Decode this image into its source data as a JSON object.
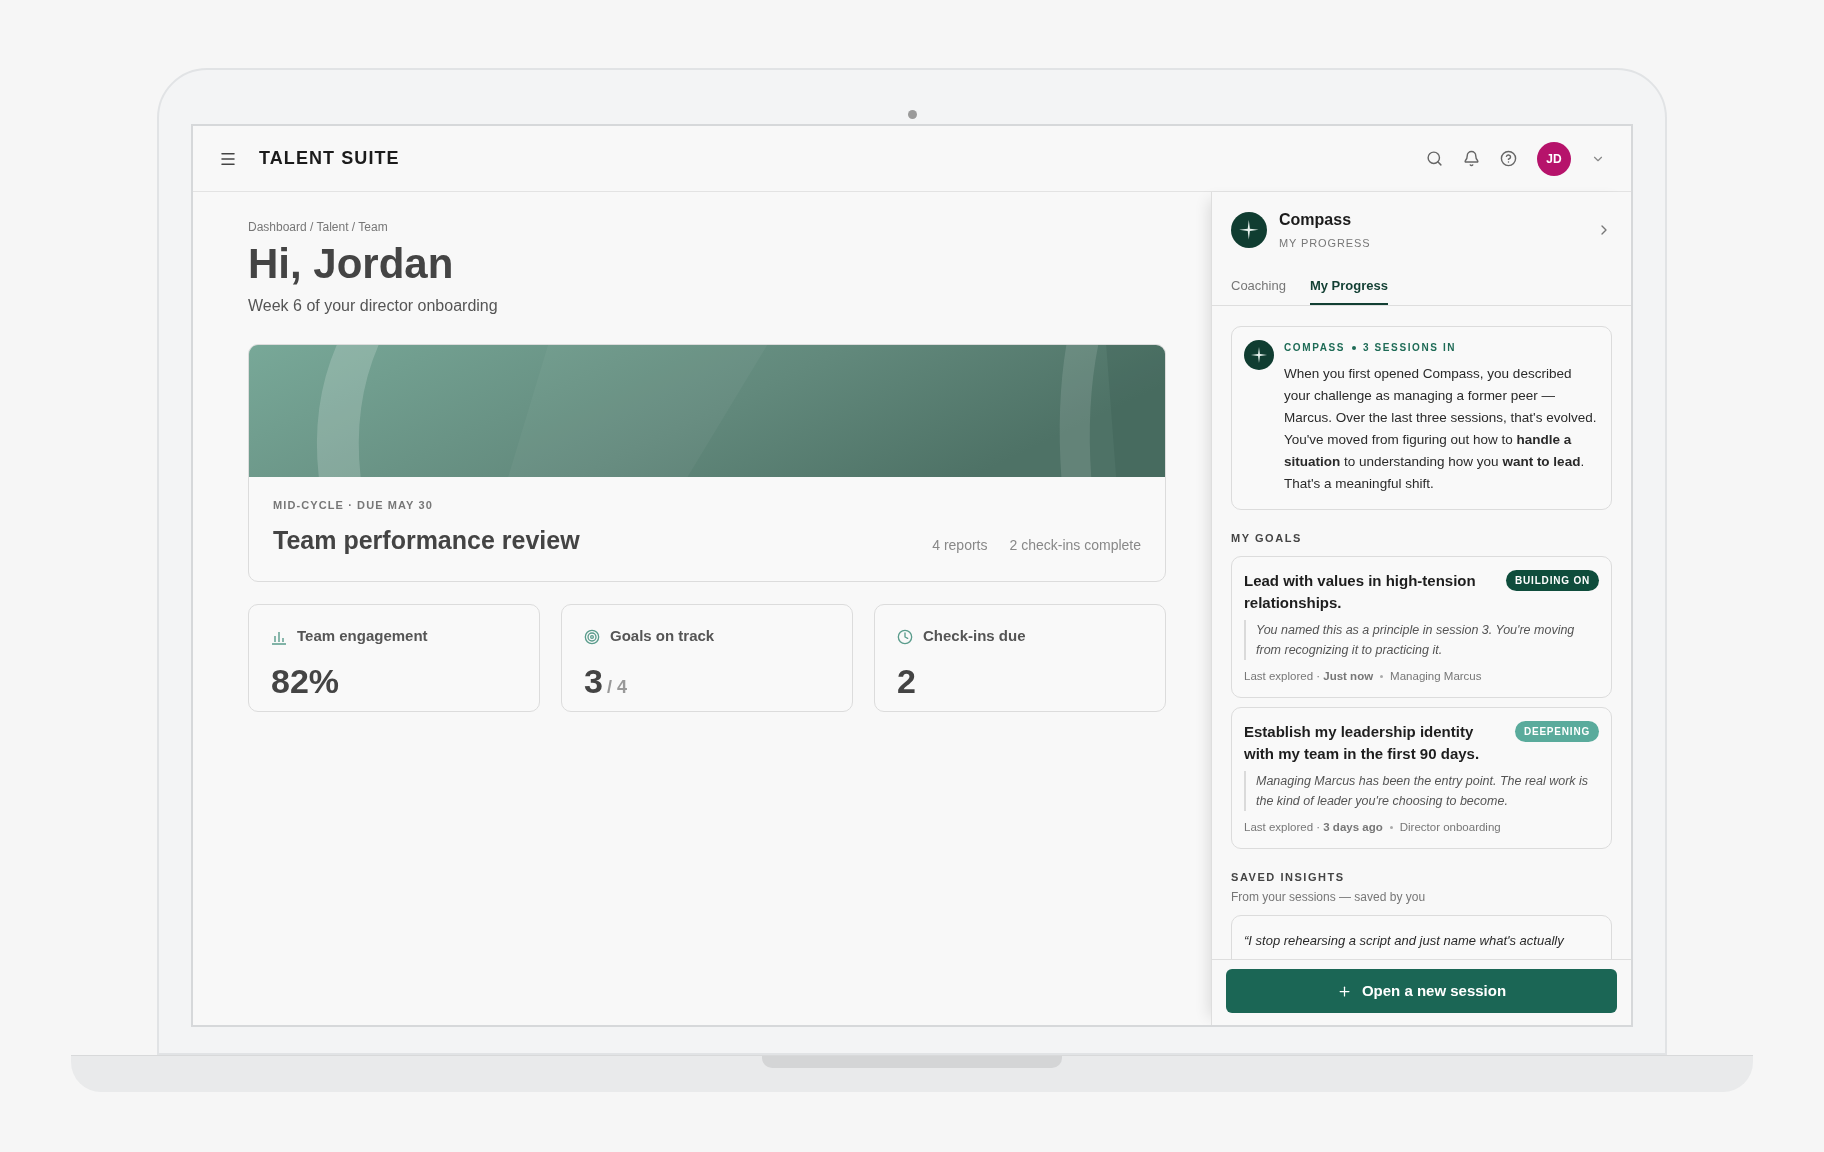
{
  "header": {
    "title": "TALENT SUITE",
    "avatar": "JD"
  },
  "main": {
    "breadcrumb": "Dashboard / Talent / Team",
    "greeting": "Hi, Jordan",
    "subtitle": "Week 6 of your director onboarding",
    "review": {
      "kind": "picture",
      "meta": "MID-CYCLE · DUE MAY 30",
      "title": "Team performance review",
      "stats": [
        "4 reports",
        "2 check-ins complete"
      ]
    },
    "metrics": [
      {
        "kind": "chart",
        "label": "Team engagement",
        "value": "82%"
      },
      {
        "kind": "target",
        "label": "Goals on track",
        "value": "3",
        "total": "/ 4"
      },
      {
        "kind": "clock",
        "label": "Check-ins due",
        "value": "2"
      }
    ]
  },
  "panel": {
    "name": "Compass",
    "subtitle": "MY PROGRESS",
    "tabs": [
      {
        "label": "Coaching",
        "selected": false
      },
      {
        "label": "My Progress",
        "selected": true
      }
    ],
    "summary": {
      "source": "COMPASS",
      "sessions": "3 SESSIONS IN",
      "text": "When you first opened Compass, you described your challenge as managing a former peer — Marcus. Over the last three sessions, that's evolved. You've moved from figuring out how to **handle a situation** to understanding how you **want to lead**. That's a meaningful shift."
    },
    "goals_heading": "MY GOALS",
    "goals": [
      {
        "title": "Lead with values in high-tension relationships.",
        "status": "BUILDING ON",
        "color": "#0f4d3c",
        "note": "You named this as a principle in session 3. You're moving from recognizing it to practicing it.",
        "explored": "Last explored · **Just now**",
        "topic": "Managing Marcus"
      },
      {
        "title": "Establish my leadership identity with my team in the first 90 days.",
        "status": "DEEPENING",
        "color": "#5aab9c",
        "note": "Managing Marcus has been the entry point. The real work is the kind of leader you're choosing to become.",
        "explored": "Last explored · **3 days ago**",
        "topic": "Director onboarding"
      }
    ],
    "insights_heading": "SAVED INSIGHTS",
    "insights_subtitle": "From your sessions — saved by you",
    "insights": [
      "“I stop rehearsing a script and just name what's actually"
    ],
    "action": "Open a new session"
  }
}
